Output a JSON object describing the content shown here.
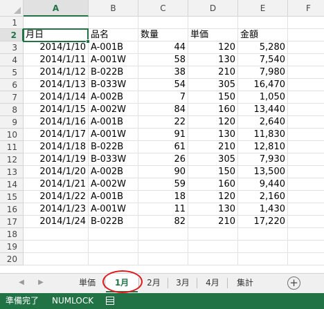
{
  "sheet": {
    "columns": [
      "A",
      "B",
      "C",
      "D",
      "E",
      "F"
    ],
    "rows": [
      "1",
      "2",
      "3",
      "4",
      "5",
      "6",
      "7",
      "8",
      "9",
      "10",
      "11",
      "12",
      "13",
      "14",
      "15",
      "16",
      "17",
      "18",
      "19",
      "20"
    ],
    "selected_column": "A",
    "selected_row": "2",
    "headers": [
      "月日",
      "品名",
      "数量",
      "単価",
      "金額"
    ],
    "data": [
      [
        "2014/1/10",
        "A-001B",
        "44",
        "120",
        "5,280"
      ],
      [
        "2014/1/11",
        "A-001W",
        "58",
        "130",
        "7,540"
      ],
      [
        "2014/1/12",
        "B-022B",
        "38",
        "210",
        "7,980"
      ],
      [
        "2014/1/13",
        "B-033W",
        "54",
        "305",
        "16,470"
      ],
      [
        "2014/1/14",
        "A-002B",
        "7",
        "150",
        "1,050"
      ],
      [
        "2014/1/15",
        "A-002W",
        "84",
        "160",
        "13,440"
      ],
      [
        "2014/1/16",
        "A-001B",
        "22",
        "120",
        "2,640"
      ],
      [
        "2014/1/17",
        "A-001W",
        "91",
        "130",
        "11,830"
      ],
      [
        "2014/1/18",
        "B-022B",
        "61",
        "210",
        "12,810"
      ],
      [
        "2014/1/19",
        "B-033W",
        "26",
        "305",
        "7,930"
      ],
      [
        "2014/1/20",
        "A-002B",
        "90",
        "150",
        "13,500"
      ],
      [
        "2014/1/21",
        "A-002W",
        "59",
        "160",
        "9,440"
      ],
      [
        "2014/1/22",
        "A-001B",
        "18",
        "120",
        "2,160"
      ],
      [
        "2014/1/23",
        "A-001W",
        "11",
        "130",
        "1,430"
      ],
      [
        "2014/1/24",
        "B-022B",
        "82",
        "210",
        "17,220"
      ]
    ]
  },
  "tabs": {
    "items": [
      "単価",
      "1月",
      "2月",
      "3月",
      "4月",
      "集計"
    ],
    "active": "1月",
    "prev_glyph": "◀",
    "next_glyph": "▶",
    "add_glyph": "+"
  },
  "status": {
    "ready": "準備完了",
    "numlock": "NUMLOCK"
  },
  "colors": {
    "accent": "#217346",
    "highlight_circle": "#e0191e"
  }
}
